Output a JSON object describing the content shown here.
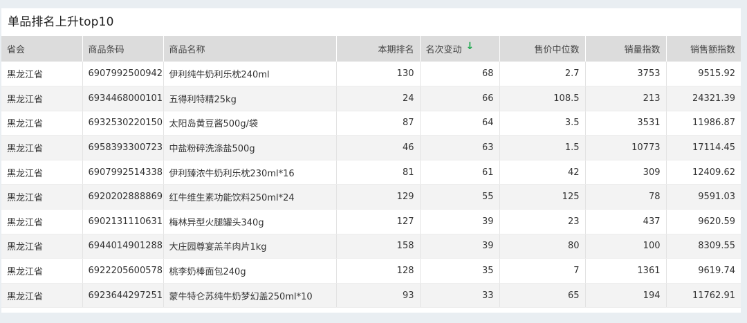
{
  "title": "单品排名上升top10",
  "sort_color": "#19a64a",
  "columns": {
    "province": "省会",
    "barcode": "商品条码",
    "name": "商品名称",
    "rank": "本期排名",
    "change": "名次变动",
    "price": "售价中位数",
    "volume": "销量指数",
    "sales": "销售额指数"
  },
  "sort": {
    "column": "change",
    "direction": "desc",
    "icon": "arrow-down-icon"
  },
  "rows": [
    {
      "province": "黑龙江省",
      "barcode": "6907992500942",
      "name": "伊利纯牛奶利乐枕240ml",
      "rank": "130",
      "change": "68",
      "price": "2.7",
      "volume": "3753",
      "sales": "9515.92"
    },
    {
      "province": "黑龙江省",
      "barcode": "6934468000101",
      "name": "五得利特精25kg",
      "rank": "24",
      "change": "66",
      "price": "108.5",
      "volume": "213",
      "sales": "24321.39"
    },
    {
      "province": "黑龙江省",
      "barcode": "6932530220150",
      "name": "太阳岛黄豆酱500g/袋",
      "rank": "87",
      "change": "64",
      "price": "3.5",
      "volume": "3531",
      "sales": "11986.87"
    },
    {
      "province": "黑龙江省",
      "barcode": "6958393300723",
      "name": "中盐粉碎洗涤盐500g",
      "rank": "46",
      "change": "63",
      "price": "1.5",
      "volume": "10773",
      "sales": "17114.45"
    },
    {
      "province": "黑龙江省",
      "barcode": "6907992514338",
      "name": "伊利臻浓牛奶利乐枕230ml*16",
      "rank": "81",
      "change": "61",
      "price": "42",
      "volume": "309",
      "sales": "12409.62"
    },
    {
      "province": "黑龙江省",
      "barcode": "6920202888869",
      "name": "红牛维生素功能饮料250ml*24",
      "rank": "129",
      "change": "55",
      "price": "125",
      "volume": "78",
      "sales": "9591.03"
    },
    {
      "province": "黑龙江省",
      "barcode": "6902131110631",
      "name": "梅林异型火腿罐头340g",
      "rank": "127",
      "change": "39",
      "price": "23",
      "volume": "437",
      "sales": "9620.59"
    },
    {
      "province": "黑龙江省",
      "barcode": "6944014901288",
      "name": "大庄园尊宴羔羊肉片1kg",
      "rank": "158",
      "change": "39",
      "price": "80",
      "volume": "100",
      "sales": "8309.55"
    },
    {
      "province": "黑龙江省",
      "barcode": "6922205600578",
      "name": "桃李奶棒面包240g",
      "rank": "128",
      "change": "35",
      "price": "7",
      "volume": "1361",
      "sales": "9619.74"
    },
    {
      "province": "黑龙江省",
      "barcode": "6923644297251",
      "name": "蒙牛特仑苏纯牛奶梦幻盖250ml*10",
      "rank": "93",
      "change": "33",
      "price": "65",
      "volume": "194",
      "sales": "11762.91"
    }
  ]
}
